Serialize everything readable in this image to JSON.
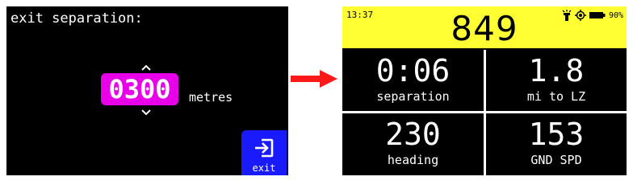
{
  "left_screen": {
    "title": "exit separation:",
    "value": "0300",
    "unit": "metres",
    "exit_label": "exit",
    "colors": {
      "value_highlight": "#e800e8",
      "exit_button": "#1a1aff"
    }
  },
  "right_screen": {
    "time": "13:37",
    "altitude": "849",
    "battery": "90%",
    "icons": [
      "flashlight-icon",
      "gps-icon",
      "battery-icon"
    ],
    "colors": {
      "header": "#ffff33"
    },
    "cells": [
      {
        "value": "0:06",
        "label": "separation"
      },
      {
        "value": "1.8",
        "label": "mi to LZ"
      },
      {
        "value": "230",
        "label": "heading"
      },
      {
        "value": "153",
        "label": "GND SPD"
      }
    ]
  }
}
